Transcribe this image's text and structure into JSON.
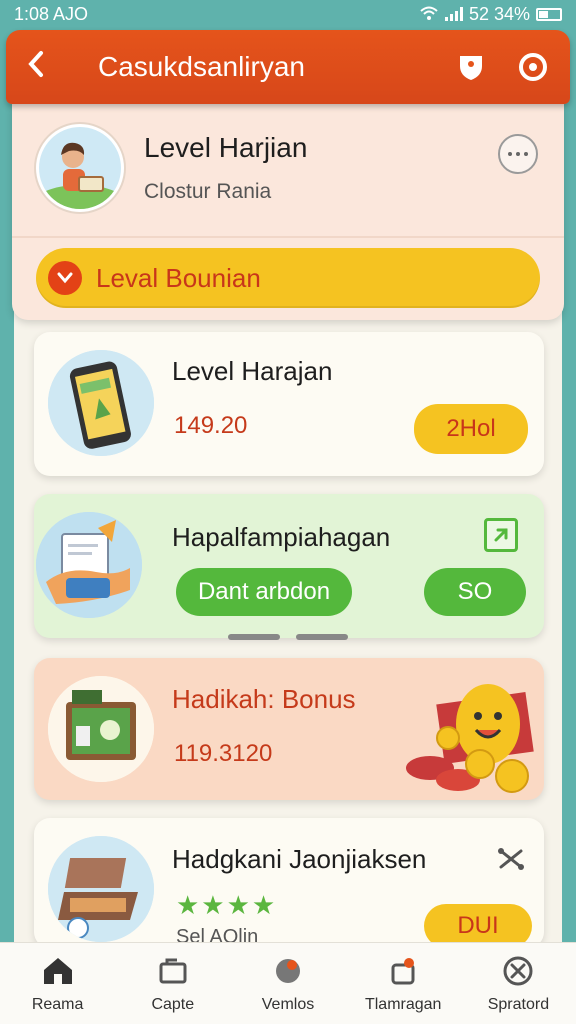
{
  "status_bar": {
    "time": "1:08 AJO",
    "battery_text": "52 34%"
  },
  "app_bar": {
    "title": "Casukdsanliryan"
  },
  "profile": {
    "title": "Level Harjian",
    "subtitle": "Clostur Rania",
    "bonus_label": "Leval Bounian"
  },
  "cards": [
    {
      "title": "Level Harajan",
      "value": "149.20",
      "button": "2Hol"
    },
    {
      "title": "Hapalfampiahagan",
      "button_primary": "Dant arbdon",
      "button_secondary": "SO"
    },
    {
      "title": "Hadikah: Bonus",
      "value": "119.3120"
    },
    {
      "title": "Hadgkani Jaonjiaksen",
      "subtitle": "Sel AOlin",
      "button": "DUI",
      "rating": "★★★★"
    }
  ],
  "bottom_nav": [
    {
      "label": "Reama",
      "icon": "home-icon"
    },
    {
      "label": "Capte",
      "icon": "card-icon"
    },
    {
      "label": "Vemlos",
      "icon": "globe-icon"
    },
    {
      "label": "Tlamragan",
      "icon": "gift-icon"
    },
    {
      "label": "Spratord",
      "icon": "close-circle-icon"
    }
  ],
  "colors": {
    "accent": "#e5541b",
    "yellow": "#f5c321",
    "green": "#54b83c",
    "teal": "#5fb2ac"
  }
}
